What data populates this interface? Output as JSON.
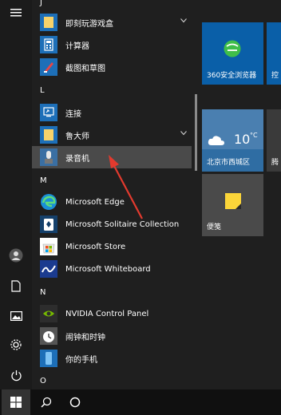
{
  "rail": {
    "icons": [
      "hamburger-menu-icon",
      "user-avatar-icon",
      "documents-icon",
      "pictures-icon",
      "settings-icon",
      "power-icon"
    ]
  },
  "applist": {
    "letter_j": "J",
    "letter_l": "L",
    "letter_m": "M",
    "letter_n": "N",
    "letter_o": "O",
    "items": [
      {
        "label": "即刻玩游戏盒",
        "icon": "folder-icon"
      },
      {
        "label": "计算器",
        "icon": "calculator-icon"
      },
      {
        "label": "截图和草图",
        "icon": "snip-sketch-icon"
      },
      {
        "label": "连接",
        "icon": "connect-icon"
      },
      {
        "label": "鲁大师",
        "icon": "folder-icon"
      },
      {
        "label": "录音机",
        "icon": "voice-recorder-icon"
      },
      {
        "label": "Microsoft Edge",
        "icon": "edge-icon"
      },
      {
        "label": "Microsoft Solitaire Collection",
        "icon": "solitaire-icon"
      },
      {
        "label": "Microsoft Store",
        "icon": "store-icon"
      },
      {
        "label": "Microsoft Whiteboard",
        "icon": "whiteboard-icon"
      },
      {
        "label": "NVIDIA Control Panel",
        "icon": "nvidia-icon"
      },
      {
        "label": "闹钟和时钟",
        "icon": "alarm-clock-icon"
      },
      {
        "label": "你的手机",
        "icon": "phone-icon"
      }
    ]
  },
  "tiles": {
    "browser360": "360安全浏览器",
    "control_partial": "控",
    "weather_temp": "10",
    "weather_unit": "°C",
    "weather_city": "北京市西城区",
    "news_partial": "腾",
    "sticky_notes": "便笺"
  },
  "colors": {
    "tile_blue": "#0a5fa8",
    "tile_gray": "#4a4a4a",
    "annotation_red": "#e23a2e"
  }
}
